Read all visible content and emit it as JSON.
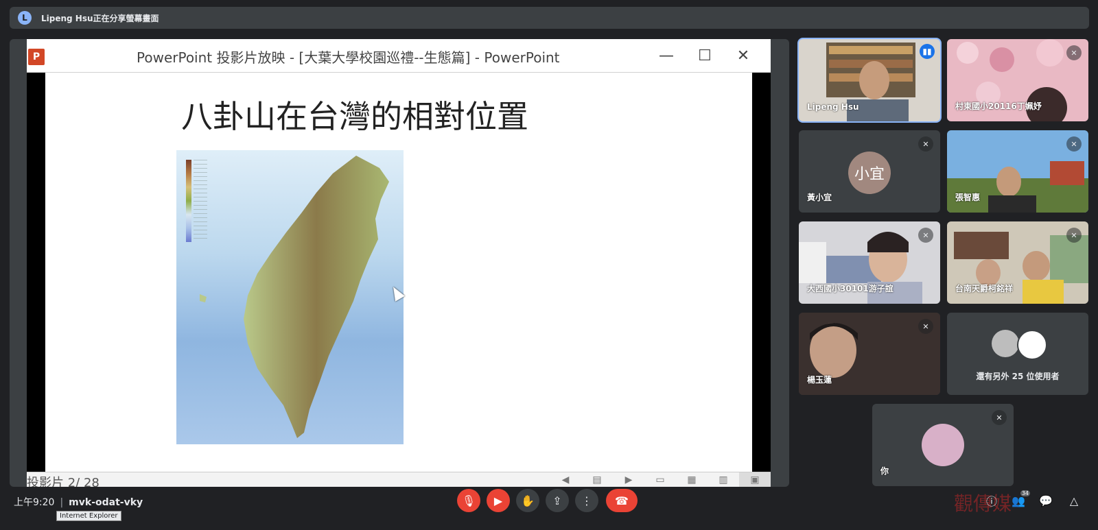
{
  "banner": {
    "avatar_letter": "L",
    "text": "Lipeng Hsu正在分享螢幕畫面"
  },
  "ppt": {
    "logo": "P",
    "title": "PowerPoint 投影片放映 - [大葉大學校園巡禮--生態篇] - PowerPoint",
    "minimize": "—",
    "maximize": "☐",
    "close": "✕",
    "slide_title": "八卦山在台灣的相對位置",
    "slide_counter": "投影片 2/ 28"
  },
  "participants": [
    {
      "name": "Lipeng Hsu",
      "speaking": true
    },
    {
      "name": "村東國小20116丁姵妤"
    },
    {
      "name": "黃小宜",
      "avatar_text": "小宜"
    },
    {
      "name": "張智惠"
    },
    {
      "name": "大西國小30101游子誼"
    },
    {
      "name": "台南天爵柯銘祥"
    },
    {
      "name": "楊玉蓮"
    },
    {
      "name": "還有另外 25 位使用者"
    },
    {
      "name": "你"
    }
  ],
  "bottom": {
    "time": "上午9:20",
    "separator": "|",
    "meeting_code": "mvk-odat-vky",
    "tooltip": "Internet Explorer",
    "participant_count": "34",
    "watermark": "觀傳媒"
  },
  "colors": {
    "accent": "#8ab4f8",
    "end_call": "#ea4335",
    "speaking": "#1a73e8",
    "background": "#202124"
  }
}
